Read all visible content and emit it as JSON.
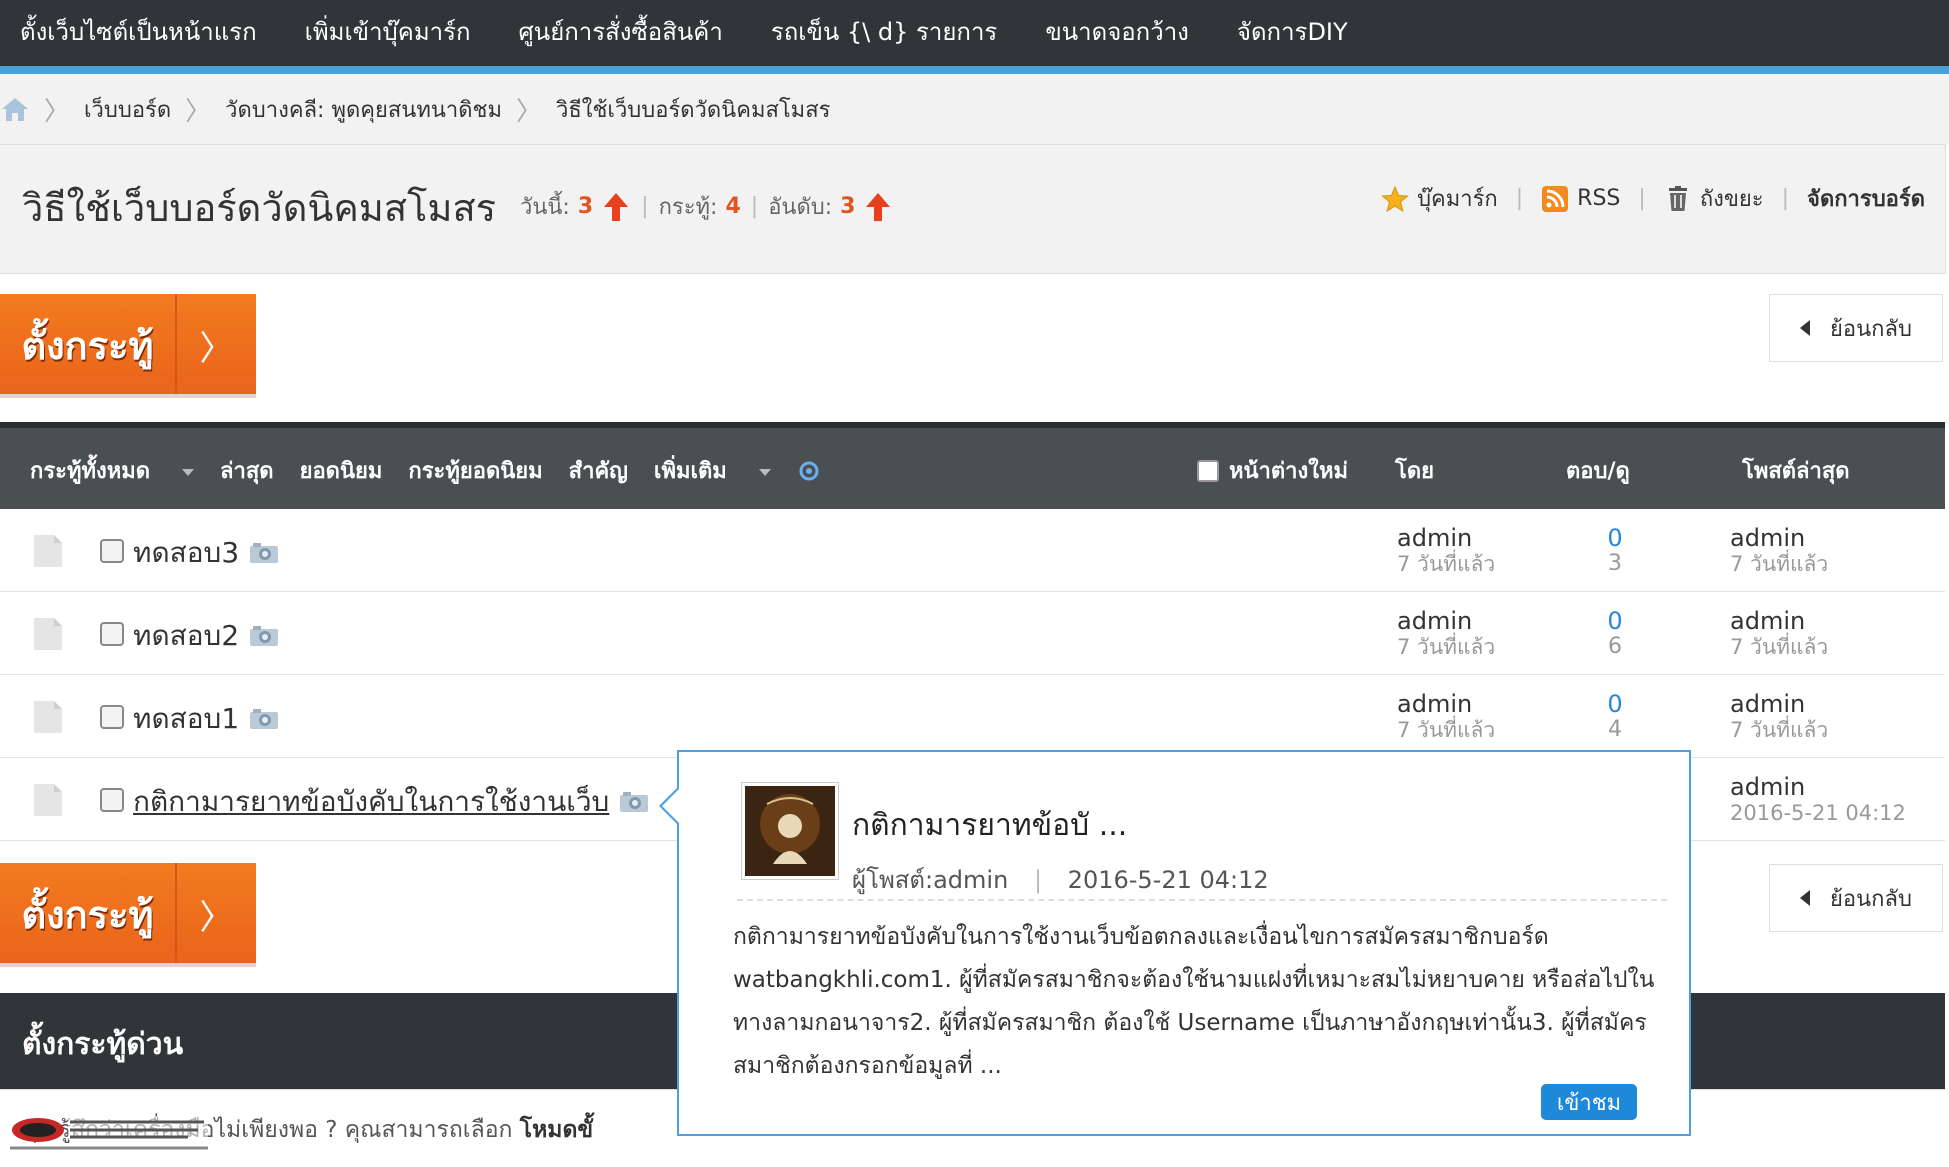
{
  "topnav": {
    "items": [
      "ตั้งเว็บไซต์เป็นหน้าแรก",
      "เพิ่มเข้าบุ๊คมาร์ก",
      "ศูนย์การสั่งซื้อสินค้า",
      "รถเข็น {\\ d} รายการ",
      "ขนาดจอกว้าง",
      "จัดการDIY"
    ]
  },
  "breadcrumb": {
    "items": [
      "เว็บบอร์ด",
      "วัดบางคลี: พูดคุยสนทนาดิชม",
      "วิธีใช้เว็บบอร์ดวัดนิคมสโมสร"
    ]
  },
  "forum": {
    "title": "วิธีใช้เว็บบอร์ดวัดนิคมสโมสร",
    "stats": {
      "today_label": "วันนี้:",
      "today": "3",
      "threads_label": "กระทู้:",
      "threads": "4",
      "rank_label": "อันดับ:",
      "rank": "3"
    },
    "actions": {
      "bookmark": "บุ๊คมาร์ก",
      "rss": "RSS",
      "trash": "ถังขยะ",
      "manage": "จัดการบอร์ด"
    }
  },
  "buttons": {
    "new_thread": "ตั้งกระทู้",
    "back": "ย้อนกลับ"
  },
  "table": {
    "tabs": [
      "กระทู้ทั้งหมด",
      "ล่าสุด",
      "ยอดนิยม",
      "กระทู้ยอดนิยม",
      "สำคัญ",
      "เพิ่มเติม"
    ],
    "new_window": "หน้าต่างใหม่",
    "col_by": "โดย",
    "col_stats": "ตอบ/ดู",
    "col_last": "โพสต์ล่าสุด",
    "rows": [
      {
        "title": "ทดสอบ3",
        "author": "admin",
        "author_time": "7 วันที่แล้ว",
        "replies": "0",
        "views": "3",
        "last_user": "admin",
        "last_time": "7 วันที่แล้ว"
      },
      {
        "title": "ทดสอบ2",
        "author": "admin",
        "author_time": "7 วันที่แล้ว",
        "replies": "0",
        "views": "6",
        "last_user": "admin",
        "last_time": "7 วันที่แล้ว"
      },
      {
        "title": "ทดสอบ1",
        "author": "admin",
        "author_time": "7 วันที่แล้ว",
        "replies": "0",
        "views": "4",
        "last_user": "admin",
        "last_time": "7 วันที่แล้ว"
      },
      {
        "title": "กติกามารยาทข้อบังคับในการใช้งานเว็บ",
        "last_user": "admin",
        "last_time": "2016-5-21 04:12"
      }
    ]
  },
  "quick_post": {
    "title": "ตั้งกระทู้ด่วน",
    "text": "คุณรู้สึกว่าเครื่องมือไม่เพียงพอ ? คุณสามารถเลือก",
    "text_bold": "โหมดขั้"
  },
  "popup": {
    "title": "กติกามารยาทข้อบั ...",
    "poster": "ผู้โพสต์:admin",
    "date": "2016-5-21 04:12",
    "excerpt": "กติกามารยาทข้อบังคับในการใช้งานเว็บข้อตกลงและเงื่อนไขการสมัครสมาชิกบอร์ด watbangkhli.com1. ผู้ที่สมัครสมาชิกจะต้องใช้นามแฝงที่เหมาะสมไม่หยาบคาย หรือส่อไปในทางลามกอนาจาร2. ผู้ที่สมัครสมาชิก ต้องใช้ Username เป็นภาษาอังกฤษเท่านั้น3. ผู้ที่สมัครสมาชิกต้องกรอกข้อมูลที่ ...",
    "view_button": "เข้าชม"
  },
  "colors": {
    "accent_orange": "#f47a1f",
    "header_dark": "#2f3538",
    "link_blue": "#2b86d9",
    "stat_red": "#e2551f"
  }
}
